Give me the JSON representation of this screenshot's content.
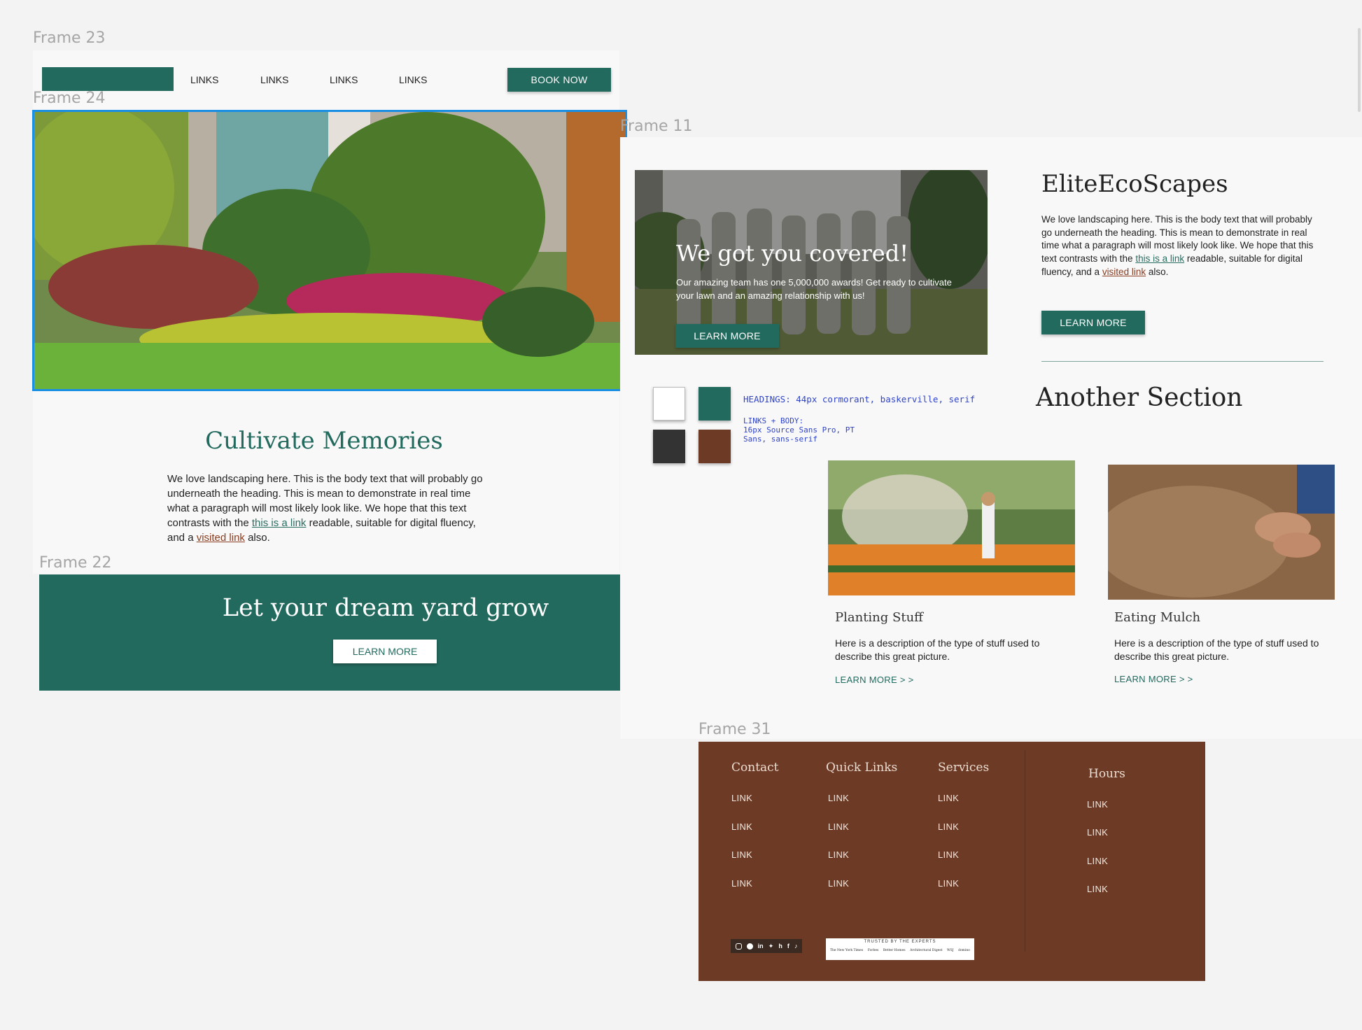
{
  "colors": {
    "green": "#226a5e",
    "brown": "#6d3a25",
    "dark": "#333333",
    "white": "#ffffff",
    "selection": "#1a8fe3"
  },
  "frames": {
    "frame23": "Frame 23",
    "frame24": "Frame 24",
    "frame11": "Frame 11",
    "frame22": "Frame 22",
    "frame31": "Frame 31"
  },
  "nav": {
    "links": [
      "LINKS",
      "LINKS",
      "LINKS",
      "LINKS"
    ],
    "book_now": "BOOK NOW"
  },
  "hero": {
    "image": "tropical-garden-photo"
  },
  "intro": {
    "heading": "Cultivate Memories",
    "body_1": "We love landscaping here. This is the body text that will probably go underneath the heading. This is mean to demonstrate in real time what a paragraph will most likely look like. We hope that this text contrasts with the ",
    "link": "this is a link",
    "body_2": " readable, suitable for digital fluency, and a ",
    "visited": "visited link",
    "body_3": " also."
  },
  "banner": {
    "heading": "Let your dream yard grow",
    "button": "LEARN MORE"
  },
  "team": {
    "heading": "We got you covered!",
    "body": "Our amazing team has one 5,000,000 awards! Get ready to cultivate your lawn and an amazing relationship with us!",
    "button": "LEARN MORE",
    "image": "team-photo"
  },
  "brand": {
    "heading": "EliteEcoScapes",
    "body_1": "We love landscaping here. This is the body text that will probably go underneath the heading. This is mean to demonstrate in real time what a paragraph will most likely look like. We hope that this text contrasts with the ",
    "link": "this is a link",
    "body_2": " readable, suitable for digital fluency, and a ",
    "visited": "visited link",
    "body_3": " also.",
    "button": "LEARN MORE"
  },
  "style_guide": {
    "headings": "HEADINGS: 44px cormorant, baskerville, serif",
    "links_1": "LINKS + BODY:",
    "links_2": "16px Source Sans Pro, PT",
    "links_3": "Sans, sans-serif"
  },
  "another_section": {
    "heading": "Another Section"
  },
  "cards": [
    {
      "title": "Planting Stuff",
      "desc": "Here is a description of the type of stuff used to describe this great picture.",
      "more": "LEARN MORE > >",
      "image": "watering-flowers-photo"
    },
    {
      "title": "Eating Mulch",
      "desc": "Here is a description of the type of stuff used to describe this great picture.",
      "more": "LEARN MORE > >",
      "image": "hands-in-soil-photo"
    }
  ],
  "footer": {
    "contact": "Contact",
    "quick_links": "Quick Links",
    "services": "Services",
    "hours": "Hours",
    "link": "LINK",
    "trusted": "TRUSTED BY THE EXPERTS",
    "press": [
      "The New York Times",
      "Forbes",
      "Better Homes",
      "Architectural Digest",
      "WSJ",
      "domino"
    ],
    "social_icons": [
      "instagram-icon",
      "pinterest-icon",
      "linkedin-icon",
      "twitter-icon",
      "houzz-icon",
      "facebook-icon",
      "tiktok-icon"
    ]
  }
}
